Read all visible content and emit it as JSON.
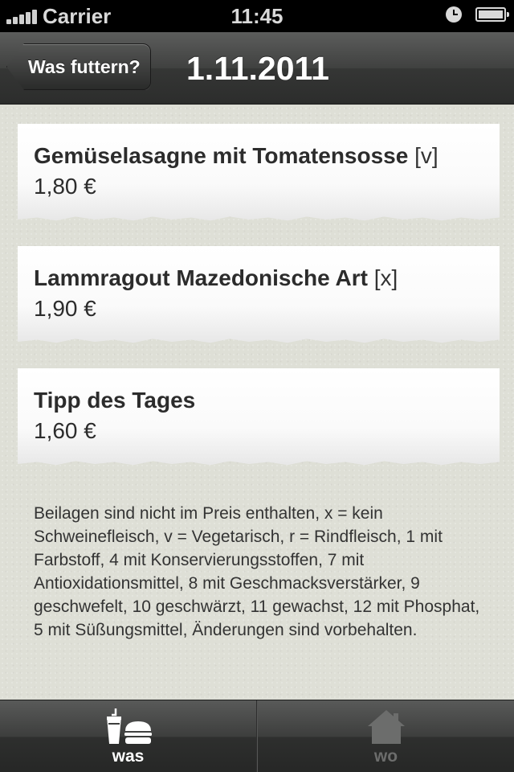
{
  "status_bar": {
    "carrier": "Carrier",
    "time": "11:45",
    "icons": [
      "signal-icon",
      "alarm-icon",
      "battery-icon"
    ]
  },
  "nav": {
    "back_label": "Was futtern?",
    "title": "1.11.2011"
  },
  "menu": [
    {
      "name": "Gemüselasagne mit Tomatensosse",
      "tag": "[v]",
      "price": "1,80 €"
    },
    {
      "name": "Lammragout Mazedonische Art",
      "tag": "[x]",
      "price": "1,90 €"
    },
    {
      "name": "Tipp des Tages",
      "tag": "",
      "price": "1,60 €"
    }
  ],
  "info": {
    "text": "Beilagen sind nicht im Preis enthalten, x = kein Schweinefleisch, v = Vegetarisch, r = Rindfleisch, 1 mit Farbstoff, 4 mit Konservierungsstoffen, 7 mit Antioxidationsmittel, 8 mit Geschmacksverstärker, 9 geschwefelt, 10 geschwärzt, 11 gewachst, 12 mit Phosphat, 5 mit Süßungsmittel, Änderungen sind vorbehalten."
  },
  "tabs": [
    {
      "label": "was",
      "icon": "drink-burger-icon",
      "selected": true
    },
    {
      "label": "wo",
      "icon": "house-icon",
      "selected": false
    }
  ],
  "colors": {
    "background": "#dedfd6",
    "nav_bar": "#404140",
    "text": "#2c2c2c",
    "tab_active": "#ffffff",
    "tab_inactive": "#6c6d6c"
  }
}
